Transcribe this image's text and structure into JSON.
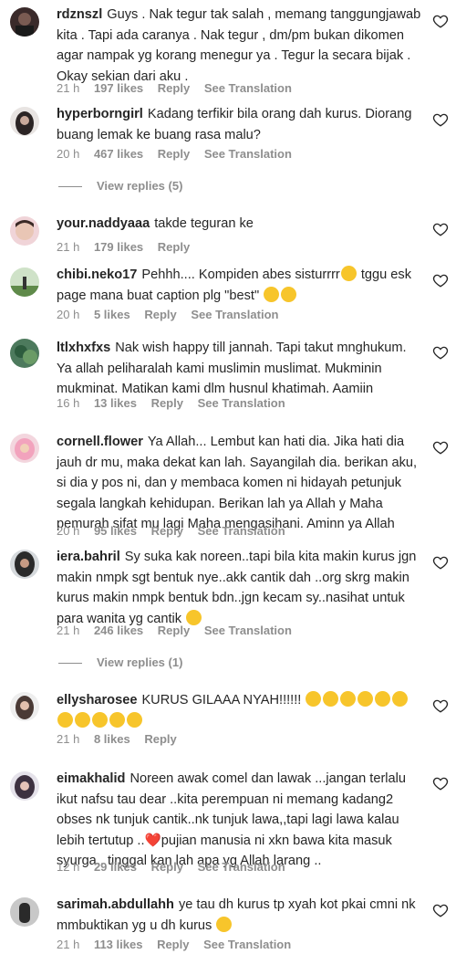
{
  "ui": {
    "reply_label": "Reply",
    "see_translation_label": "See Translation"
  },
  "comments": [
    {
      "username": "rdznszl",
      "text": "Guys . Nak tegur tak salah , memang tanggungjawab kita . Tapi ada caranya . Nak tegur , dm/pm bukan dikomen agar nampak yg korang menegur ya . Tegur la secara bijak . Okay sekian dari aku .",
      "time": "21 h",
      "likes": "197 likes"
    },
    {
      "username": "hyperborngirl",
      "text": "Kadang terfikir bila orang dah kurus. Diorang buang lemak ke buang rasa malu?",
      "time": "20 h",
      "likes": "467 likes",
      "view_replies": "View replies (5)"
    },
    {
      "username": "your.naddyaaa",
      "text": "takde teguran ke",
      "time": "21 h",
      "likes": "179 likes"
    },
    {
      "username": "chibi.neko17",
      "text": "Pehhh.... Kompiden abes sisturrrr",
      "text2": " tggu esk page mana buat caption plg \"best\"",
      "time": "20 h",
      "likes": "5 likes"
    },
    {
      "username": "ltlxhxfxs",
      "text": "Nak wish happy till jannah. Tapi takut mnghukum. Ya allah peliharalah kami muslimin muslimat. Mukminin mukminat. Matikan kami dlm husnul khatimah. Aamiin",
      "time": "16 h",
      "likes": "13 likes"
    },
    {
      "username": "cornell.flower",
      "text": "Ya Allah... Lembut kan hati dia. Jika hati dia jauh dr mu, maka dekat kan lah. Sayangilah dia. berikan aku, si dia y pos ni, dan y membaca komen ni hidayah petunjuk segala langkah kehidupan. Berikan lah ya Allah y Maha pemurah sifat mu lagi Maha mengasihani. Aminn ya Allah",
      "time": "20 h",
      "likes": "95 likes"
    },
    {
      "username": "iera.bahril",
      "text": "Sy suka kak noreen..tapi bila kita makin kurus jgn makin nmpk sgt bentuk nye..akk cantik dah ..org skrg makin kurus makin nmpk bentuk bdn..jgn kecam sy..nasihat untuk para wanita yg cantik",
      "time": "21 h",
      "likes": "246 likes",
      "view_replies": "View replies (1)"
    },
    {
      "username": "ellysharosee",
      "text": "KURUS GILAAA NYAH!!!!!!",
      "time": "21 h",
      "likes": "8 likes"
    },
    {
      "username": "eimakhalid",
      "text": "Noreen awak comel dan lawak ...jangan terlalu ikut nafsu tau dear ..kita perempuan ni memang kadang2 obses nk tunjuk cantik..nk tunjuk lawa,,tapi lagi lawa kalau lebih tertutup ..",
      "heart": "❤️",
      "text2": "pujian manusia ni xkn bawa kita masuk syurga.. tinggal kan lah apa yg Allah larang ..",
      "time": "12 h",
      "likes": "29 likes"
    },
    {
      "username": "sarimah.abdullahh",
      "text": "ye tau dh kurus tp xyah kot pkai cmni nk mmbuktikan yg u dh kurus",
      "time": "21 h",
      "likes": "113 likes"
    }
  ]
}
